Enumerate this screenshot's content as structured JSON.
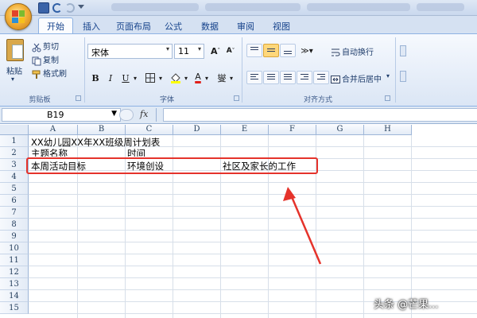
{
  "qat_colors": {
    "ribbon_bg": "#dbe6f5",
    "accent": "#15428b",
    "annotation_red": "#e5332b"
  },
  "ribbon_tabs": [
    "开始",
    "插入",
    "页面布局",
    "公式",
    "数据",
    "审阅",
    "视图"
  ],
  "clipboard": {
    "paste": "粘贴",
    "cut": "剪切",
    "copy": "复制",
    "format_painter": "格式刷",
    "group_label": "剪贴板"
  },
  "font": {
    "font_name": "宋体",
    "font_size": "11",
    "grow": "A",
    "shrink": "A",
    "bold": "B",
    "italic": "I",
    "underline": "U",
    "font_color_letter": "A",
    "phonetic": "燮",
    "group_label": "字体"
  },
  "alignment": {
    "wrap_text": "自动换行",
    "merge_center": "合并后居中",
    "group_label": "对齐方式"
  },
  "formula_bar": {
    "name_box": "B19",
    "fx": "fx",
    "formula": ""
  },
  "columns": [
    "A",
    "B",
    "C",
    "D",
    "E",
    "F",
    "G",
    "H"
  ],
  "rows": [
    "1",
    "2",
    "3",
    "4",
    "5",
    "6",
    "7",
    "8",
    "9",
    "10",
    "11",
    "12",
    "13",
    "14",
    "15"
  ],
  "cells": {
    "r1_a": "XX幼儿园XX年XX班级周计划表",
    "r2_a": "主题名称",
    "r2_c": "时间",
    "r3_a": "本周活动目标",
    "r3_c": "环境创设",
    "r3_e": "社区及家长的工作"
  },
  "watermark": "头条 @芒果..."
}
